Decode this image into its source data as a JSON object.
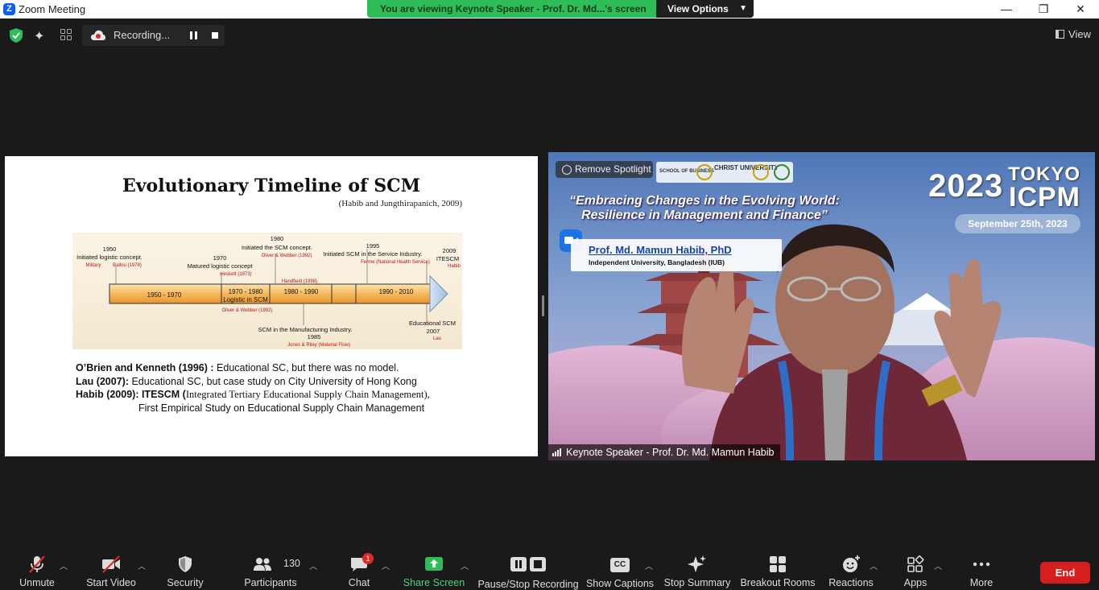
{
  "window": {
    "title": "Zoom Meeting",
    "minimize": "—",
    "maximize": "❐",
    "close": "✕"
  },
  "banner": {
    "text": "You are viewing Keynote Speaker - Prof. Dr. Md...'s screen",
    "view_options": "View Options"
  },
  "topbar": {
    "recording_label": "Recording...",
    "view_label": "View"
  },
  "slide": {
    "title": "Evolutionary Timeline of SCM",
    "citation": "(Habib and Jungthirapanich, 2009)",
    "timeline": {
      "segments": [
        "1950 - 1970",
        "1970 - 1980",
        "Logistic in SCM",
        "1980 - 1990",
        "1990 - 2010"
      ],
      "above": [
        {
          "year": "1950",
          "text": "Initiated logistic concept.",
          "ref1": "Military",
          "ref2": "Ballou (1978)"
        },
        {
          "year": "1970",
          "text": "Matured logistic concept",
          "ref1": "Heskett (1973)"
        },
        {
          "year": "1980",
          "text": "Initiated the SCM concept.",
          "ref1": "Oliver & Webber (1992)"
        },
        {
          "year": "1995",
          "text": "Initiated SCM in the Service Industry.",
          "ref1": "Ferme (National Health Service)"
        },
        {
          "year": "2009",
          "text": "ITESCM",
          "ref1": "Habib"
        }
      ],
      "below": [
        {
          "text": "Handfield (1998)"
        },
        {
          "text": "Oliver & Webber (1992)"
        },
        {
          "year": "1985",
          "text": "SCM in the Manufacturing Industry.",
          "ref1": "Jones & Riley (Material Flow)"
        },
        {
          "year": "2007",
          "text": "Educational SCM",
          "ref1": "Lau"
        }
      ]
    },
    "lines": [
      {
        "bold": "O’Brien and Kenneth (1996) :",
        "rest": " Educational SC, but there  was no model."
      },
      {
        "bold": "Lau (2007):",
        "rest": " Educational SC, but case study on City University of Hong Kong"
      },
      {
        "bold": "Habib (2009): ITESCM (",
        "serif": "Integrated Tertiary Educational Supply Chain Management),"
      },
      {
        "indent": "First Empirical Study on Educational Supply Chain Management"
      }
    ]
  },
  "video": {
    "remove_spotlight": "Remove Spotlight",
    "logo1": "SCHOOL OF BUSINESS",
    "logo2": "CHRIST UNIVERSITY",
    "tagline1": "“Embracing Changes in the Evolving World:",
    "tagline2": "Resilience in Management and Finance”",
    "brand_year": "2023",
    "brand_city": "TOKYO",
    "brand_event": "ICPM",
    "brand_date": "September 25th, 2023",
    "speaker_name": "Prof. Md. Mamun Habib, PhD",
    "speaker_org": "Independent University, Bangladesh (IUB)",
    "tile_name": "Keynote Speaker - Prof. Dr. Md. Mamun Habib"
  },
  "toolbar": {
    "unmute": "Unmute",
    "start_video": "Start Video",
    "security": "Security",
    "participants": "Participants",
    "participants_count": "130",
    "chat": "Chat",
    "chat_badge": "1",
    "share_screen": "Share Screen",
    "pause_stop": "Pause/Stop Recording",
    "show_captions": "Show Captions",
    "cc": "CC",
    "stop_summary": "Stop Summary",
    "breakout_rooms": "Breakout Rooms",
    "reactions": "Reactions",
    "apps": "Apps",
    "more": "More",
    "end": "End"
  },
  "colors": {
    "accent_green": "#2ebd59",
    "end_red": "#d41f1f",
    "zoom_blue": "#0b5cff"
  }
}
